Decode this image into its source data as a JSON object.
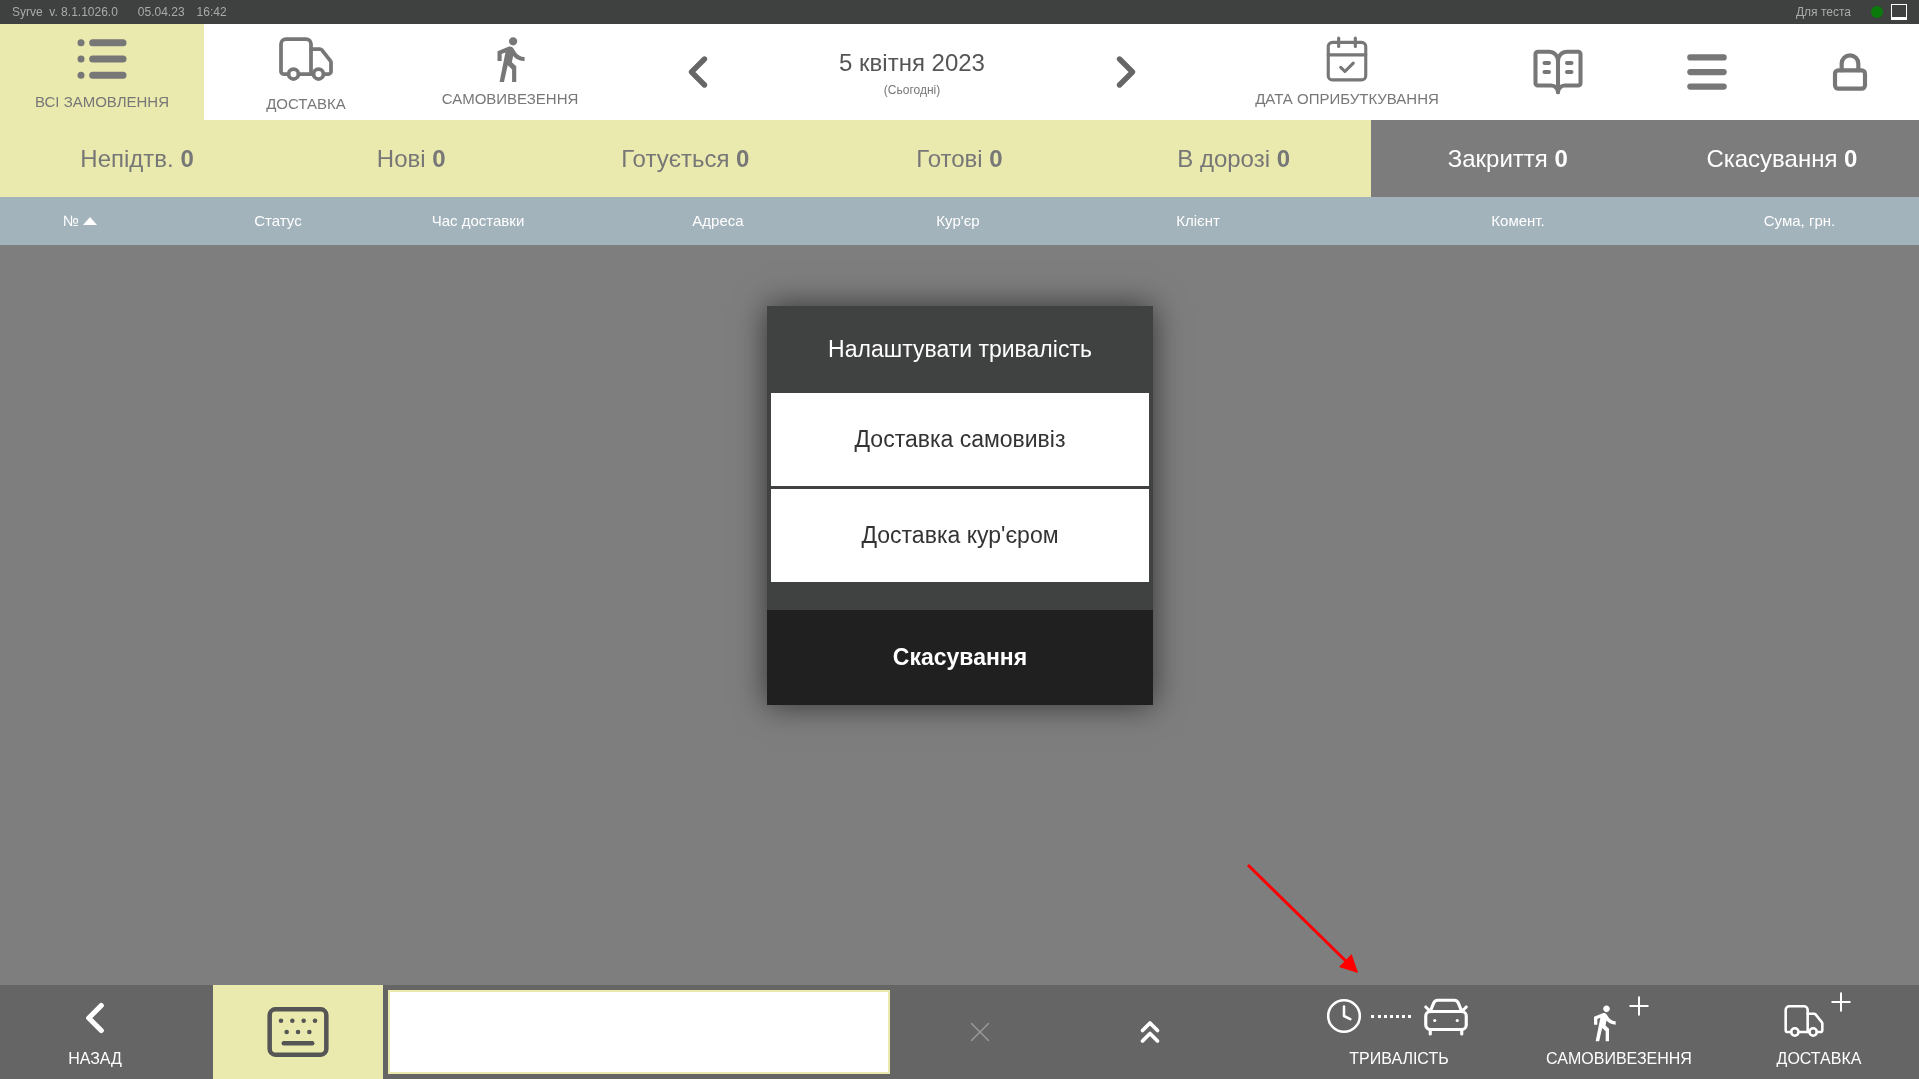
{
  "title_bar": {
    "version": "Syrve  v. 8.1.1026.0",
    "date": "05.04.23",
    "time": "16:42",
    "environment": "Для теста",
    "online": true
  },
  "nav_tabs": [
    {
      "kind": "list",
      "label": "ВСІ ЗАМОВЛЕННЯ",
      "selected": true
    },
    {
      "kind": "delivery",
      "label": "ДОСТАВКА",
      "selected": false
    },
    {
      "kind": "pickup",
      "label": "САМОВИВЕЗЕННЯ",
      "selected": false
    }
  ],
  "date_picker": {
    "date": "5 квітня 2023",
    "note": "(Сьогодні)"
  },
  "date_button": {
    "label": "ДАТА ОПРИБУТКУВАННЯ"
  },
  "status_filters": [
    {
      "label": "Непідтв.",
      "count": "0",
      "selected": true
    },
    {
      "label": "Нові",
      "count": "0",
      "selected": true
    },
    {
      "label": "Готується",
      "count": "0",
      "selected": true
    },
    {
      "label": "Готові",
      "count": "0",
      "selected": true
    },
    {
      "label": "В дорозі",
      "count": "0",
      "selected": true
    },
    {
      "label": "Закриття",
      "count": "0",
      "selected": false
    },
    {
      "label": "Скасування",
      "count": "0",
      "selected": false
    }
  ],
  "columns": [
    {
      "label": "№",
      "sorted": true
    },
    {
      "label": "Статус",
      "sorted": false
    },
    {
      "label": "Час доставки",
      "sorted": false
    },
    {
      "label": "Адреса",
      "sorted": false
    },
    {
      "label": "Кур'єр",
      "sorted": false
    },
    {
      "label": "Клієнт",
      "sorted": false
    },
    {
      "label": "Комент.",
      "sorted": false
    },
    {
      "label": "Сума, грн.",
      "sorted": false
    }
  ],
  "dialog": {
    "title": "Налаштувати тривалість",
    "options": [
      "Доставка самовивіз",
      "Доставка кур'єром"
    ],
    "cancel": "Скасування"
  },
  "bottom_bar": {
    "back": "НАЗАД",
    "keyboard_on": true,
    "actions": [
      {
        "kind": "duration",
        "label": "ТРИВАЛІСТЬ"
      },
      {
        "kind": "new_pickup",
        "label": "САМОВИВЕЗЕННЯ"
      },
      {
        "kind": "new_delivery",
        "label": "ДОСТАВКА"
      }
    ]
  }
}
